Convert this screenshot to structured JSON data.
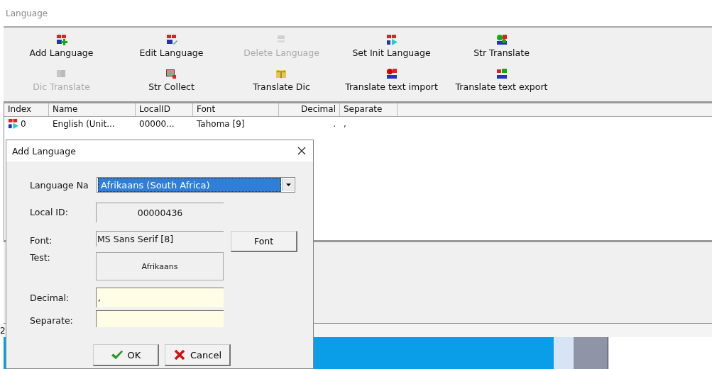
{
  "window": {
    "title": "Language"
  },
  "toolbar": {
    "rows": [
      [
        {
          "label": "Add Language",
          "kind": "add",
          "disabled": false
        },
        {
          "label": "Edit Language",
          "kind": "edit",
          "disabled": false
        },
        {
          "label": "Delete Language",
          "kind": "delete",
          "disabled": true
        },
        {
          "label": "Set Init Language",
          "kind": "init",
          "disabled": false
        },
        {
          "label": "Str Translate",
          "kind": "translate",
          "disabled": false
        }
      ],
      [
        {
          "label": "Dic Translate",
          "kind": "dic",
          "disabled": true
        },
        {
          "label": "Str Collect",
          "kind": "collect",
          "disabled": false
        },
        {
          "label": "Translate Dic",
          "kind": "book",
          "disabled": false
        },
        {
          "label": "Translate text import",
          "kind": "import",
          "disabled": false
        },
        {
          "label": "Translate text export",
          "kind": "export",
          "disabled": false
        }
      ]
    ]
  },
  "table": {
    "columns": [
      "Index",
      "Name",
      "LocalID",
      "Font",
      "Decimal",
      "Separate"
    ],
    "rows": [
      {
        "cells": [
          "0",
          "English (Unit...",
          "00000...",
          "Tahoma [9]",
          ".",
          ","
        ]
      }
    ]
  },
  "status_bar": {
    "text": "2"
  },
  "dialog": {
    "title": "Add Language",
    "language_name": {
      "label": "Language Na",
      "value": "Afrikaans (South Africa)",
      "highlighted": true
    },
    "local_id": {
      "label": "Local ID:",
      "value": "00000436"
    },
    "font": {
      "label": "Font:",
      "value": "MS Sans Serif [8]",
      "button": "Font"
    },
    "test": {
      "label": "Test:",
      "sample": "Afrikaans"
    },
    "decimal": {
      "label": "Decimal:",
      "value": ","
    },
    "separate": {
      "label": "Separate:"
    },
    "buttons": [
      {
        "label": "OK",
        "kind": "ok"
      },
      {
        "label": "Cancel",
        "kind": "cancel"
      }
    ]
  }
}
